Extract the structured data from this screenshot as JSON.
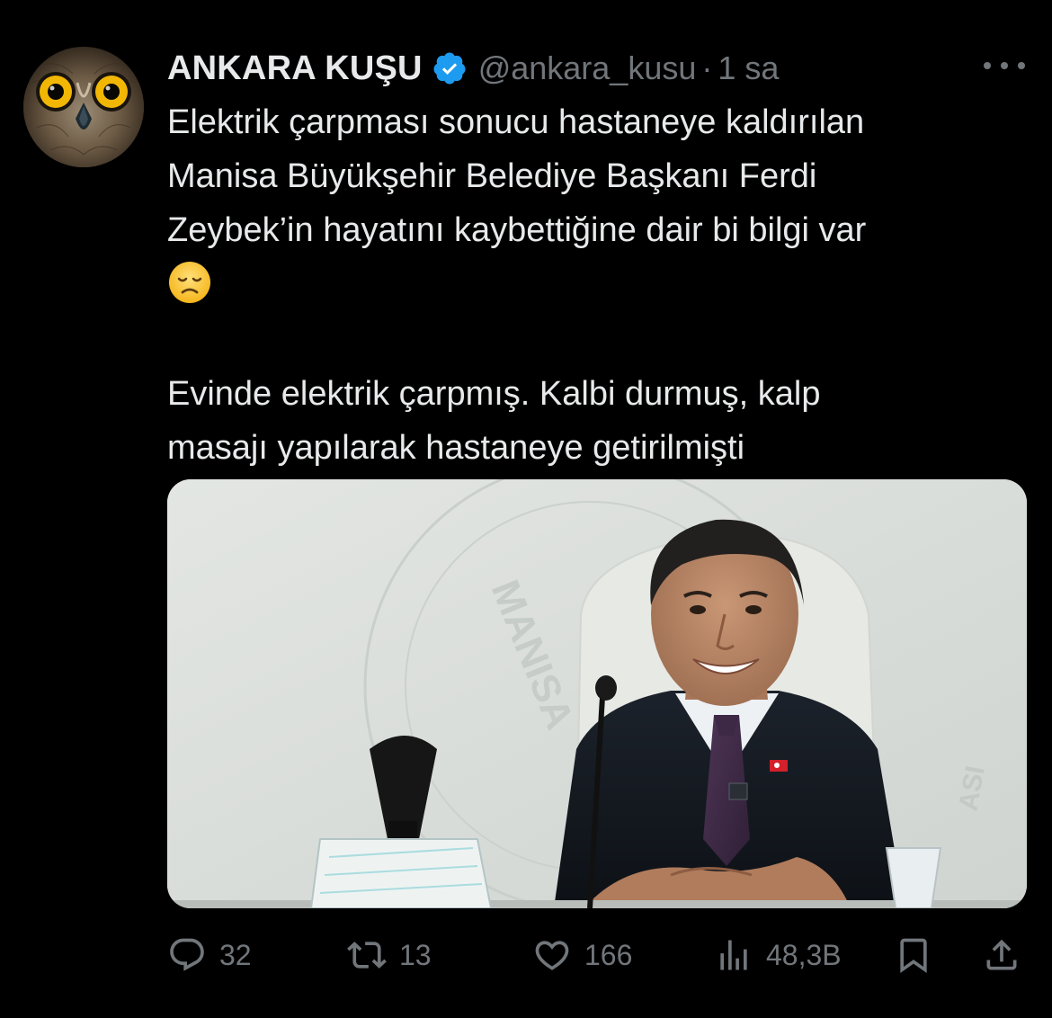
{
  "tweet": {
    "author": {
      "display_name": "ANKARA KUŞU",
      "handle": "@ankara_kusu",
      "verified": true,
      "avatar_icon": "owl-avatar"
    },
    "time_separator": "·",
    "time": "1 sa",
    "more_icon": "more-horizontal-icon",
    "text_lines": [
      "Elektrik çarpması sonucu hastaneye kaldırılan",
      "Manisa Büyükşehir Belediye Başkanı Ferdi",
      "Zeybek’in hayatını kaybettiğine dair bi bilgi var"
    ],
    "emoji": "😞",
    "second_paragraph": [
      "Evinde elektrik çarpmış. Kalbi durmuş, kalp",
      "masajı yapılarak hastaneye getirilmişti"
    ],
    "media": {
      "watermark_text": "MANISA"
    },
    "actions": {
      "replies": {
        "icon": "reply-icon",
        "count": "32"
      },
      "reposts": {
        "icon": "repost-icon",
        "count": "13"
      },
      "likes": {
        "icon": "heart-icon",
        "count": "166"
      },
      "views": {
        "icon": "views-icon",
        "count": "48,3B"
      },
      "bookmark": {
        "icon": "bookmark-icon"
      },
      "share": {
        "icon": "share-icon"
      }
    }
  },
  "colors": {
    "background": "#000000",
    "text": "#e7e9ea",
    "muted": "#71767b",
    "verified_blue": "#1d9bf0"
  }
}
